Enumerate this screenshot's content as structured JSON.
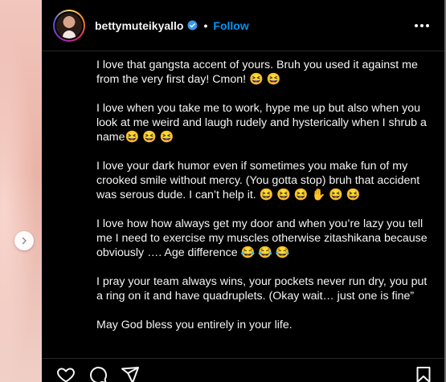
{
  "post": {
    "username": "bettymuteikyallo",
    "separator": "•",
    "follow_label": "Follow"
  },
  "caption": {
    "paragraphs": [
      "I love that gangsta accent of yours. Bruh you used it against me from the very first day! Cmon! 😆 😆",
      "I love when you take me to work, hype me up but also when you look at me weird and laugh rudely and hysterically when I shrub a name😆 😆 😆",
      "I love your dark humor even if sometimes you make fun of my crooked smile without mercy. (You gotta stop) bruh that accident was serous dude. I can’t help it. 😆 😆 😆 ✋ 😆 😆",
      "I love how how always get my door and when you’re lazy you tell me I need to exercise my muscles otherwise zitashikana because obviously …. Age difference 😂 😂 😂",
      "I pray your team always wins, your pockets never run dry, you put a ring on it and have quadruplets. (Okay wait… just one is fine”",
      "May God bless you entirely in your life."
    ]
  },
  "icons": {
    "verified": "verified-badge-icon",
    "more": "more-options-icon",
    "like": "heart-icon",
    "comment": "comment-icon",
    "share": "share-icon",
    "save": "bookmark-icon",
    "next": "chevron-right-icon"
  },
  "colors": {
    "background": "#000000",
    "text": "#f5f5f5",
    "link": "#0095f6",
    "verified": "#3897f0"
  }
}
